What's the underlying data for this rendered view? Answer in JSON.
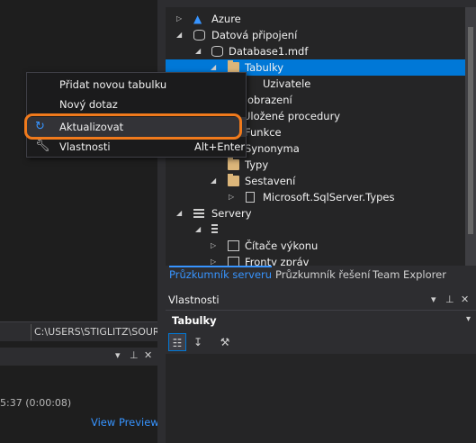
{
  "tree": {
    "items": [
      {
        "label": "Azure",
        "icon": "azure-icon"
      },
      {
        "label": "Datová připojení",
        "icon": "data-connections-icon"
      },
      {
        "label": "Database1.mdf",
        "icon": "database-icon"
      },
      {
        "label": "Tabulky",
        "icon": "folder-icon"
      },
      {
        "label": "Uzivatele",
        "icon": "table-icon"
      },
      {
        "label": "obrazení",
        "icon": "folder-icon"
      },
      {
        "label": "Uložené procedury",
        "icon": "folder-icon"
      },
      {
        "label": "Funkce",
        "icon": "folder-icon"
      },
      {
        "label": "Synonyma",
        "icon": "folder-icon"
      },
      {
        "label": "Typy",
        "icon": "folder-icon"
      },
      {
        "label": "Sestavení",
        "icon": "folder-icon"
      },
      {
        "label": "Microsoft.SqlServer.Types",
        "icon": "file-icon"
      },
      {
        "label": "Servery",
        "icon": "servers-icon"
      },
      {
        "label": "",
        "icon": "server-icon"
      },
      {
        "label": "Čítače výkonu",
        "icon": "performance-counter-icon"
      },
      {
        "label": "Fronty zpráv",
        "icon": "message-queue-icon"
      }
    ]
  },
  "tabs": [
    {
      "label": "Průzkumník serveru"
    },
    {
      "label": "Průzkumník řešení"
    },
    {
      "label": "Team Explorer"
    }
  ],
  "context_menu": {
    "items": [
      {
        "label": "Přidat novou tabulku",
        "shortcut": ""
      },
      {
        "label": "Nový dotaz",
        "shortcut": ""
      },
      {
        "label": "Aktualizovat",
        "shortcut": "",
        "icon": "refresh-icon"
      },
      {
        "label": "Vlastnosti",
        "shortcut": "Alt+Enter",
        "icon": "wrench-icon"
      }
    ]
  },
  "properties": {
    "title": "Vlastnosti",
    "object": "Tabulky"
  },
  "editor": {
    "path": "C:\\USERS\\STIGLITZ\\SOUR..."
  },
  "output": {
    "time": "5:37 (0:00:08)",
    "view_preview": "View Preview"
  },
  "colors": {
    "accent": "#0078d7",
    "link": "#3794ff",
    "highlight_ring": "#f07a1c",
    "folder": "#dcb67a"
  }
}
